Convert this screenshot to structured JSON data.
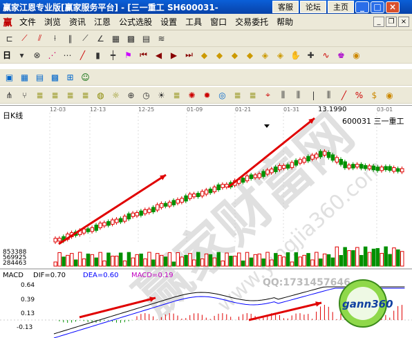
{
  "window": {
    "title": "赢家江恩专业版[赢家服务平台] - [三一重工 SH600031-",
    "links": [
      "客服",
      "论坛",
      "主页"
    ]
  },
  "menu": {
    "logo": "赢",
    "items": [
      "文件",
      "浏览",
      "资讯",
      "江恩",
      "公式选股",
      "设置",
      "工具",
      "窗口",
      "交易委托",
      "帮助"
    ]
  },
  "toolbar": {
    "period_label": "日"
  },
  "chart": {
    "panel_label": "日K线",
    "dates": [
      "12-03",
      "12-13",
      "12-25",
      "01-09",
      "01-21",
      "01-31",
      "03-01"
    ],
    "price_high_label": "13.1990",
    "stock_label": "600031 三一重工",
    "volume_labels": [
      "853388",
      "569925",
      "284463"
    ],
    "macd": {
      "name": "MACD",
      "dif_label": "DIF=0.70",
      "dea_label": "DEA=0.60",
      "macd_label": "MACD=0.19",
      "axis_labels": [
        "0.64",
        "0.39",
        "0.13",
        "-0.13"
      ]
    },
    "watermark": {
      "main": "赢家财富网",
      "url": "www.yingjia360.com",
      "qq": "QQ:1731457646",
      "logo": "gann360"
    },
    "colors": {
      "up": "#e00000",
      "down": "#009000",
      "arrow": "#e00000",
      "dif": "#000000",
      "dea": "#0000ff"
    }
  }
}
